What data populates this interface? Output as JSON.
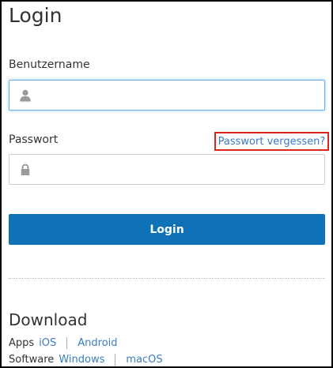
{
  "login": {
    "title": "Login",
    "username_label": "Benutzername",
    "username_value": "",
    "username_placeholder": "",
    "username_icon": "user-icon",
    "password_label": "Passwort",
    "password_value": "",
    "password_placeholder": "",
    "password_icon": "lock-icon",
    "forgot_password_link": "Passwort vergessen?",
    "submit_label": "Login"
  },
  "download": {
    "title": "Download",
    "apps_label": "Apps",
    "apps_links": [
      "iOS",
      "Android"
    ],
    "software_label": "Software",
    "software_links": [
      "Windows",
      "macOS"
    ]
  },
  "colors": {
    "primary_button": "#0f72b7",
    "link": "#3b7cbf",
    "focus_border": "#66afe9",
    "highlight_box": "#d9261c"
  }
}
